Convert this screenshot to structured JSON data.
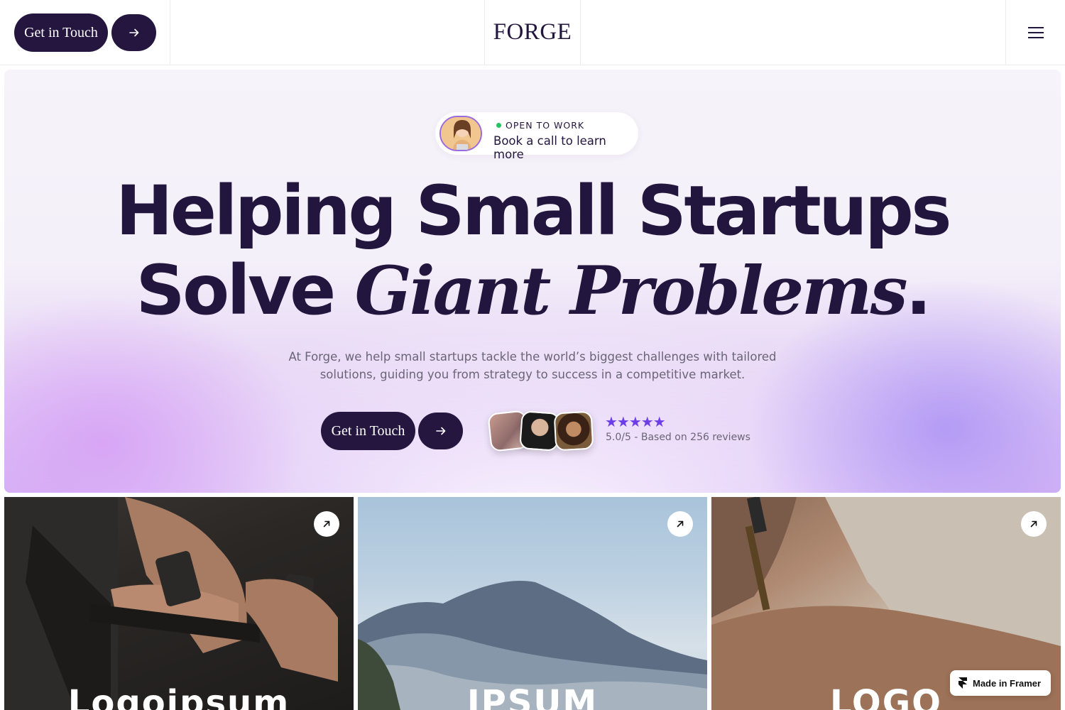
{
  "nav": {
    "cta_label": "Get in Touch",
    "logo": "FORGE",
    "menu_icon": "hamburger-menu-icon",
    "arrow_icon": "arrow-right-icon"
  },
  "hero": {
    "status_badge": "OPEN TO WORK",
    "status_cta": "Book a call to learn more",
    "headline_line1": "Helping Small Startups",
    "headline_line2_regular": "Solve ",
    "headline_line2_italic": "Giant Problems",
    "headline_period": ".",
    "subtext": "At Forge, we help small startups tackle the world’s biggest challenges with tailored solutions, guiding you from strategy to success in a competitive market.",
    "cta_label": "Get in Touch",
    "stars": "★★★★★",
    "rating_text": "5.0/5 - Based on 256 reviews",
    "star_color": "#6d3ee8"
  },
  "cards": [
    {
      "brand": "Logoipsum",
      "arrow_icon": "arrow-up-right-icon"
    },
    {
      "brand": "IPSUM",
      "arrow_icon": "arrow-up-right-icon"
    },
    {
      "brand": "LOGO",
      "arrow_icon": "arrow-up-right-icon"
    }
  ],
  "badge": {
    "label": "Made in Framer",
    "icon": "framer-logo-icon"
  },
  "colors": {
    "brand_dark": "#24163f",
    "status_green": "#22c55e"
  }
}
